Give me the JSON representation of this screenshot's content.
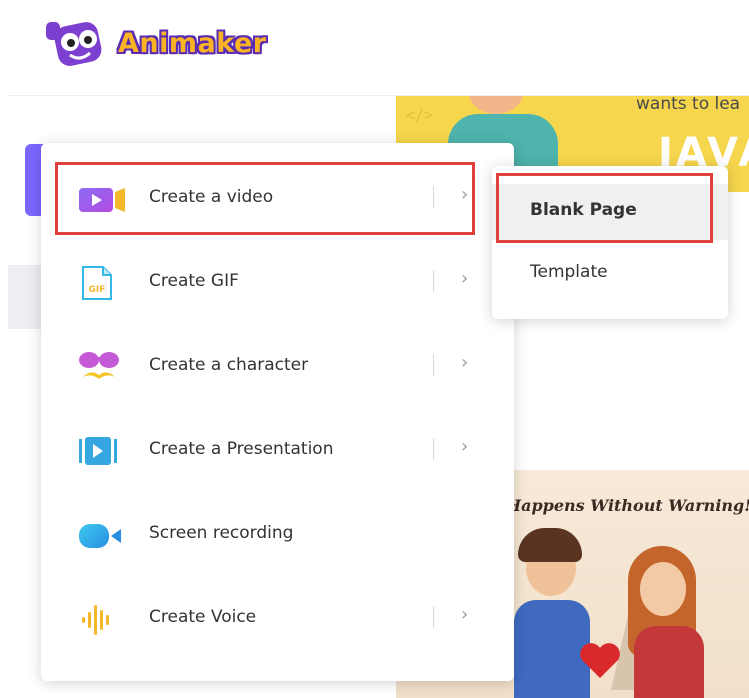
{
  "header": {
    "logo_text": "Animaker"
  },
  "background": {
    "top_card": {
      "caption": "wants to lea",
      "big_text": "JAVA",
      "code_tag": "</>"
    },
    "bottom_card": {
      "headline": "Happens Without Warning!"
    }
  },
  "menu": {
    "items": [
      {
        "label": "Create a video",
        "icon": "video-camera-icon",
        "has_submenu": true
      },
      {
        "label": "Create GIF",
        "icon": "gif-file-icon",
        "has_submenu": true
      },
      {
        "label": "Create a character",
        "icon": "character-glasses-icon",
        "has_submenu": true
      },
      {
        "label": "Create a Presentation",
        "icon": "presentation-play-icon",
        "has_submenu": true
      },
      {
        "label": "Screen recording",
        "icon": "screen-recording-icon",
        "has_submenu": false
      },
      {
        "label": "Create Voice",
        "icon": "voice-waveform-icon",
        "has_submenu": true
      }
    ],
    "chevron": "›"
  },
  "submenu": {
    "items": [
      {
        "label": "Blank Page",
        "active": true
      },
      {
        "label": "Template",
        "active": false
      }
    ]
  },
  "colors": {
    "accent_purple": "#7a67ff",
    "highlight_red": "#e0403e",
    "logo_yellow": "#f9b323"
  }
}
